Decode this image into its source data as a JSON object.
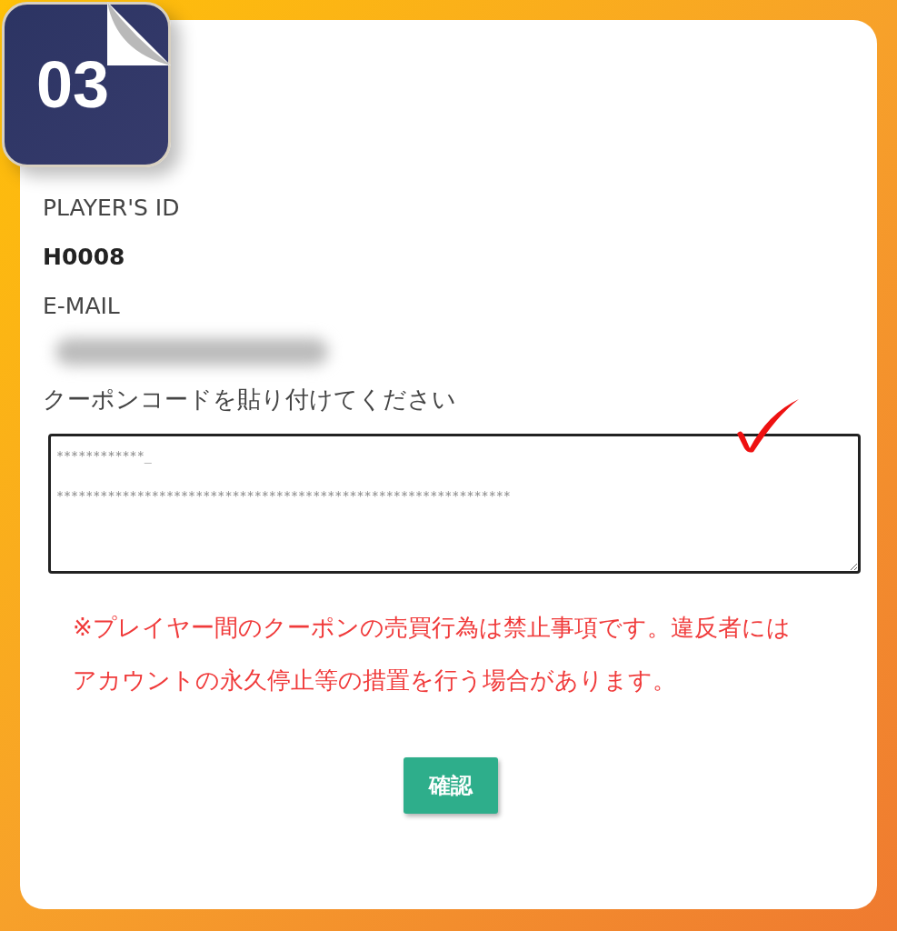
{
  "badge": "03",
  "fields": [
    {
      "label": "PLAYER'S ID",
      "value": "H0008"
    },
    {
      "label": "E-MAIL",
      "redacted": true
    }
  ],
  "coupon": {
    "label": "クーポンコードを貼り付けてください",
    "value": "************_\n**************************************************************",
    "checked": true
  },
  "warning": "※プレイヤー間のクーポンの売買行為は禁止事項です。違反者にはアカウントの永久停止等の措置を行う場合があります。",
  "button": "確認"
}
